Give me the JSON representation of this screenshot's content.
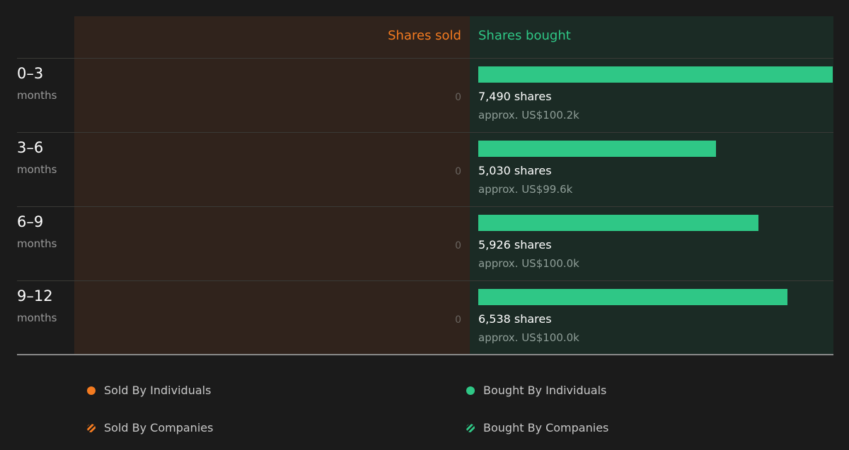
{
  "columns": {
    "sold": "Shares sold",
    "bought": "Shares bought"
  },
  "chart_data": {
    "type": "bar",
    "categories": [
      "0–3",
      "3–6",
      "6–9",
      "9–12"
    ],
    "category_unit": "months",
    "series": [
      {
        "name": "Shares sold",
        "values": [
          0,
          0,
          0,
          0
        ],
        "color": "#f47b20"
      },
      {
        "name": "Shares bought",
        "values": [
          7490,
          5030,
          5926,
          6538
        ],
        "color": "#2fc786"
      }
    ],
    "shares_labels": [
      "7,490 shares",
      "5,030 shares",
      "5,926 shares",
      "6,538 shares"
    ],
    "approx_labels": [
      "approx. US$100.2k",
      "approx. US$99.6k",
      "approx. US$100.0k",
      "approx. US$100.0k"
    ],
    "sold_labels": [
      "0",
      "0",
      "0",
      "0"
    ],
    "legend": [
      {
        "label": "Sold By Individuals",
        "color": "#f47b20",
        "style": "solid"
      },
      {
        "label": "Bought By Individuals",
        "color": "#2fc786",
        "style": "solid"
      },
      {
        "label": "Sold By Companies",
        "color": "#f47b20",
        "style": "hatched"
      },
      {
        "label": "Bought By Companies",
        "color": "#2fc786",
        "style": "hatched"
      }
    ]
  }
}
